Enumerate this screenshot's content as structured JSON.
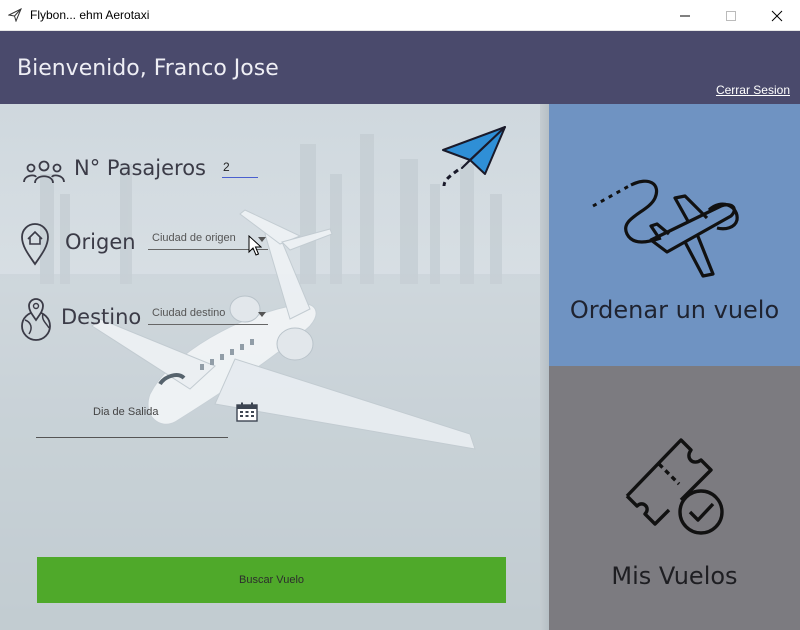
{
  "window": {
    "title": "Flybon... ehm Aerotaxi"
  },
  "header": {
    "welcome": "Bienvenido, Franco Jose",
    "logout": "Cerrar Sesion"
  },
  "form": {
    "passengers_label": "N° Pasajeros",
    "passengers_value": "2",
    "origin_label": "Origen",
    "origin_placeholder": "Ciudad de origen",
    "destination_label": "Destino",
    "destination_placeholder": "Ciudad destino",
    "date_placeholder": "Dia de Salida",
    "search_button": "Buscar Vuelo"
  },
  "tiles": {
    "order_label": "Ordenar un vuelo",
    "flights_label": "Mis Vuelos"
  },
  "colors": {
    "header_bg": "#4a4a6c",
    "order_tile": "#6f93c2",
    "flights_tile": "#7c7b80",
    "search_button": "#4fa92a",
    "paper_plane": "#2f8fd6"
  },
  "icons": {
    "app": "paper-plane-icon",
    "passengers": "people-icon",
    "origin": "home-pin-icon",
    "destination": "globe-pin-icon",
    "logo": "paper-plane-icon",
    "date": "calendar-icon",
    "order": "airplane-route-icon",
    "flights": "ticket-check-icon"
  }
}
